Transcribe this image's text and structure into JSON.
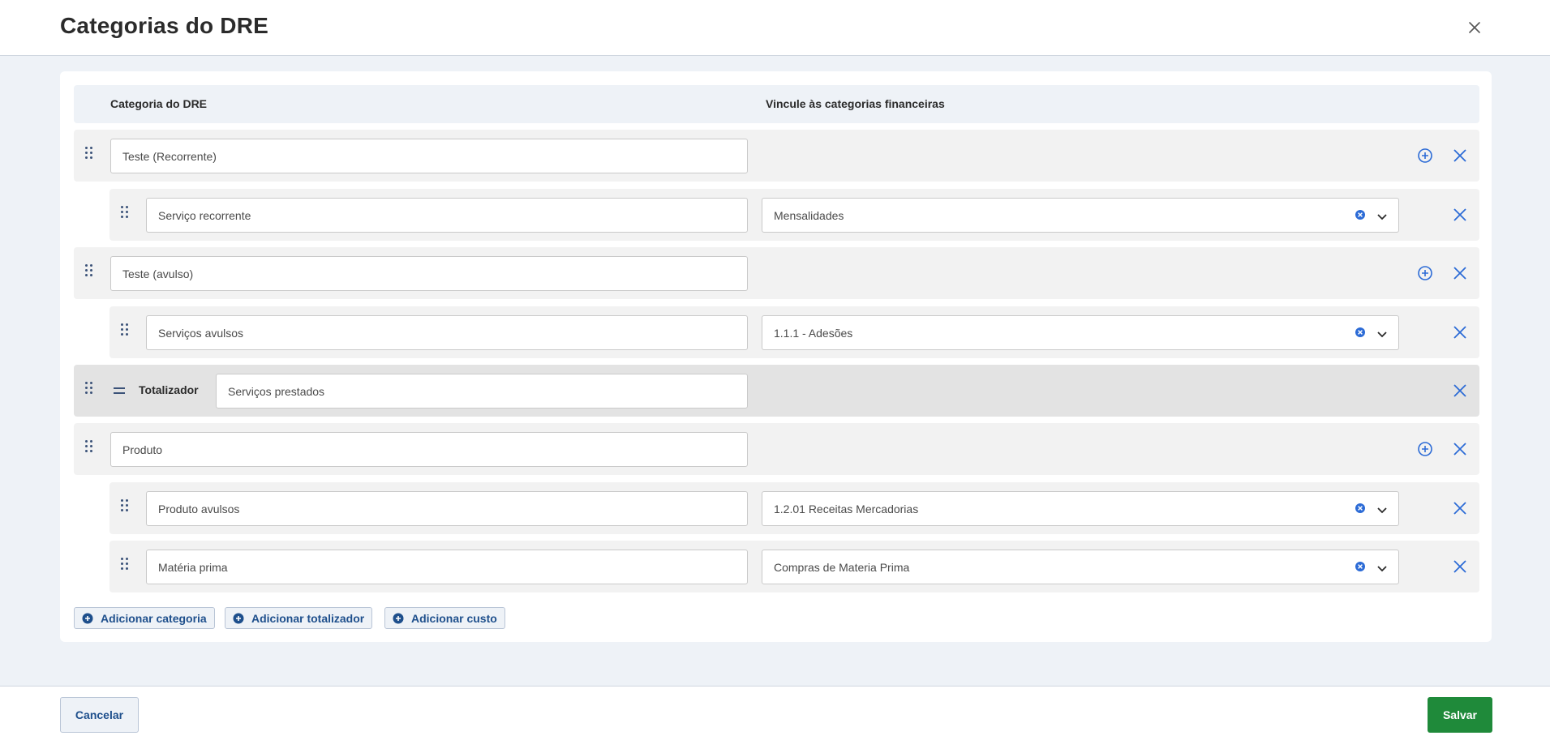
{
  "dialog": {
    "title": "Categorias do DRE"
  },
  "table": {
    "col_category": "Categoria do DRE",
    "col_link": "Vincule às categorias financeiras"
  },
  "rows": [
    {
      "kind": "category",
      "name": "Teste (Recorrente)"
    },
    {
      "kind": "subcategory",
      "name": "Serviço recorrente",
      "link": "Mensalidades"
    },
    {
      "kind": "category",
      "name": "Teste (avulso)"
    },
    {
      "kind": "subcategory",
      "name": "Serviços avulsos",
      "link": "1.1.1 - Adesões"
    },
    {
      "kind": "totalizer",
      "label": "Totalizador",
      "name": "Serviços prestados"
    },
    {
      "kind": "category",
      "name": "Produto"
    },
    {
      "kind": "subcategory",
      "name": "Produto avulsos",
      "link": "1.2.01 Receitas Mercadorias"
    },
    {
      "kind": "subcategory",
      "name": "Matéria prima",
      "link": "Compras de Materia Prima"
    }
  ],
  "actions": {
    "add_category": "Adicionar categoria",
    "add_totalizer": "Adicionar totalizador",
    "add_cost": "Adicionar custo"
  },
  "footer": {
    "cancel": "Cancelar",
    "save": "Salvar"
  },
  "icons": {
    "close": "close-icon",
    "drag": "drag-handle-icon",
    "add": "plus-circle-icon",
    "remove": "x-icon",
    "clear": "clear-circle-icon",
    "dropdown": "chevron-down-icon",
    "equals": "equals-icon"
  },
  "colors": {
    "accent": "#1e4f8c",
    "link_icon": "#2c6bd6",
    "save": "#1f8a3a",
    "background": "#eef2f7",
    "row": "#f2f2f2",
    "total_row": "#e3e3e3"
  }
}
